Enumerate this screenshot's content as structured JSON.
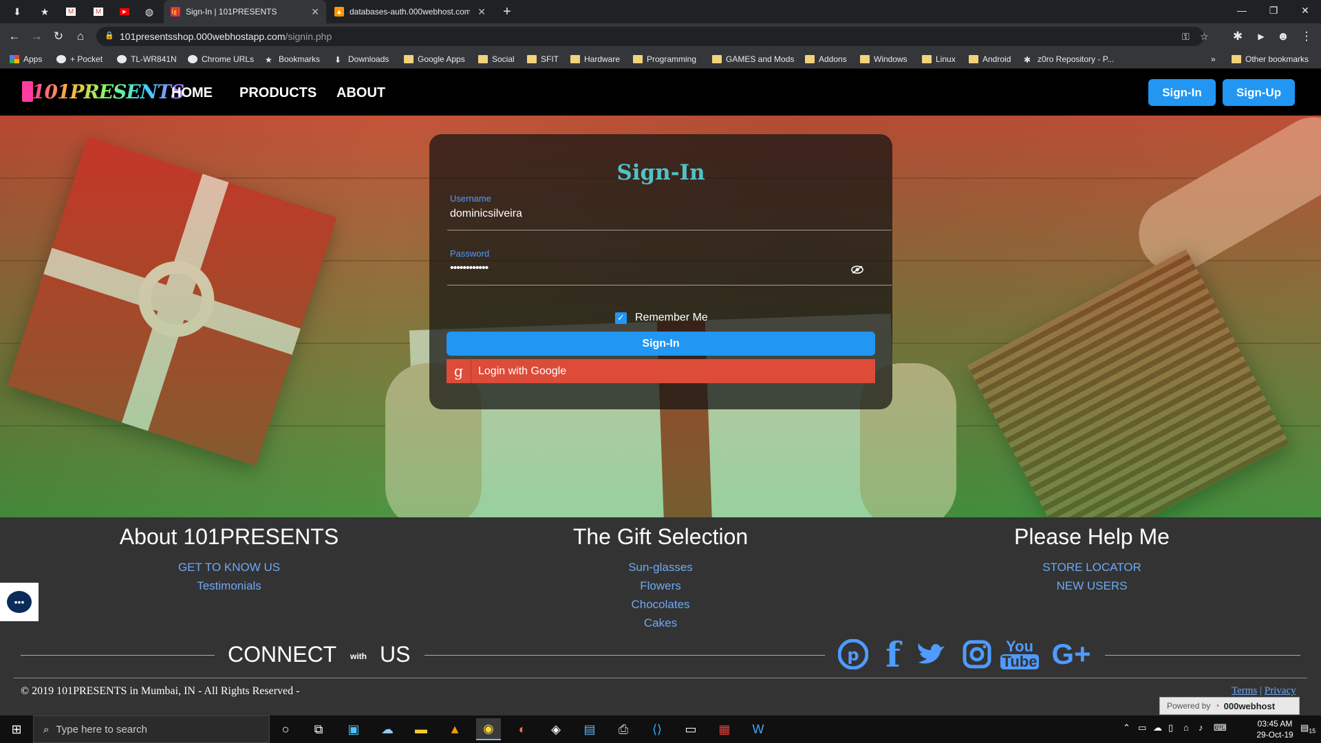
{
  "browser": {
    "tabs": [
      {
        "title": "Sign-In | 101PRESENTS",
        "active": true
      },
      {
        "title": "databases-auth.000webhost.com",
        "active": false
      }
    ],
    "url_host": "101presentsshop.000webhostapp.com",
    "url_path": "/signin.php",
    "bookmarks": [
      "Apps",
      "+ Pocket",
      "TL-WR841N",
      "Chrome URLs",
      "Bookmarks",
      "Downloads",
      "Google Apps",
      "Social",
      "SFIT",
      "Hardware",
      "Programming",
      "GAMES and Mods",
      "Addons",
      "Windows",
      "Linux",
      "Android",
      "z0ro Repository - P...",
      "Other bookmarks"
    ]
  },
  "site": {
    "logo_text": "101PRESENTS",
    "nav": [
      "HOME",
      "PRODUCTS",
      "ABOUT"
    ],
    "signin_button": "Sign-In",
    "signup_button": "Sign-Up"
  },
  "login": {
    "title": "Sign-In",
    "username_label": "Username",
    "username_value": "dominicsilveira",
    "password_label": "Password",
    "password_value": "••••••••••••",
    "remember_label": "Remember Me",
    "remember_checked": true,
    "signin_label": "Sign-In",
    "google_label": "Login with Google",
    "google_icon_glyph": "g"
  },
  "footer": {
    "col1": {
      "title": "About 101PRESENTS",
      "links": [
        "GET TO KNOW US",
        "Testimonials"
      ]
    },
    "col2": {
      "title": "The Gift Selection",
      "links": [
        "Sun-glasses",
        "Flowers",
        "Chocolates",
        "Cakes"
      ]
    },
    "col3": {
      "title": "Please Help Me",
      "links": [
        "STORE LOCATOR",
        "NEW USERS"
      ]
    },
    "connect_left": "CONNECT",
    "connect_with": "with",
    "connect_right": "US",
    "social": [
      {
        "name": "pinterest-icon",
        "glyph": "P"
      },
      {
        "name": "facebook-icon",
        "glyph": "f"
      },
      {
        "name": "twitter-icon",
        "glyph": "t"
      },
      {
        "name": "instagram-icon",
        "glyph": "◎"
      },
      {
        "name": "youtube-icon",
        "glyph": "You Tube"
      },
      {
        "name": "google-plus-icon",
        "glyph": "G+"
      }
    ],
    "copyright": "© 2019 101PRESENTS in Mumbai, IN - All Rights Reserved -",
    "terms": "Terms",
    "privacy": "Privacy",
    "powered_by": "Powered by",
    "powered_brand": "000webhost"
  },
  "taskbar": {
    "search_placeholder": "Type here to search",
    "time": "03:45 AM",
    "date": "29-Oct-19",
    "notifications": "15"
  },
  "colors": {
    "accent_blue": "#2196f3",
    "google_red": "#dd4b39",
    "title_teal": "#4fc3c7",
    "link_blue": "#6ea9f5"
  }
}
